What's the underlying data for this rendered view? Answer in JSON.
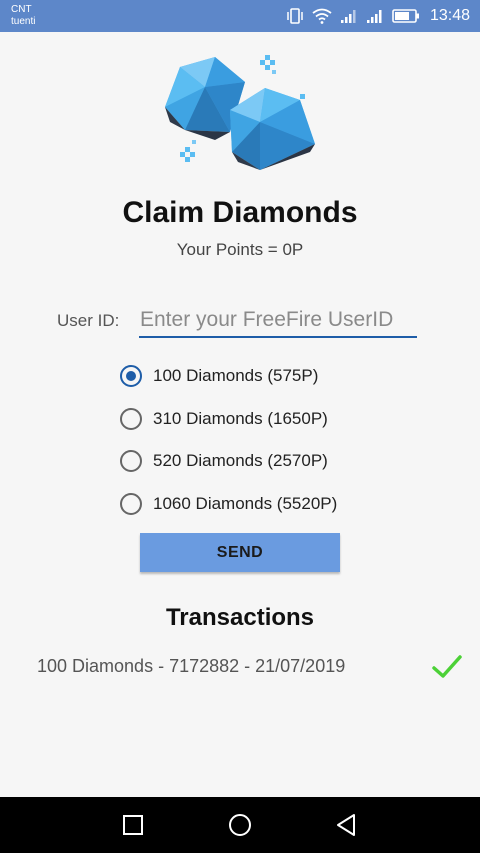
{
  "status_bar": {
    "carrier_line1": "CNT",
    "carrier_line2": "tuenti",
    "time": "13:48",
    "icons": [
      "vibrate-icon",
      "wifi-icon",
      "signal-icon",
      "signal-icon",
      "battery-icon"
    ]
  },
  "header": {
    "title": "Claim Diamonds",
    "points_text": "Your Points = 0P",
    "image": "diamond-gem-icon"
  },
  "form": {
    "user_id_label": "User ID:",
    "user_id_placeholder": "Enter your FreeFire UserID",
    "user_id_value": "",
    "options": [
      {
        "label": "100 Diamonds (575P)",
        "checked": true
      },
      {
        "label": "310 Diamonds (1650P)",
        "checked": false
      },
      {
        "label": "520 Diamonds (2570P)",
        "checked": false
      },
      {
        "label": "1060 Diamonds (5520P)",
        "checked": false
      }
    ],
    "send_label": "SEND"
  },
  "transactions": {
    "title": "Transactions",
    "items": [
      {
        "text": "100 Diamonds - 7172882 - 21/07/2019",
        "status_icon": "check-icon",
        "status_color": "#4cd137"
      }
    ]
  },
  "colors": {
    "status_bar": "#5d87c9",
    "accent": "#1e5da8",
    "button": "#6a9be0",
    "gem": "#3a9de0"
  },
  "nav_bar": {
    "icons": [
      "recents-square-icon",
      "home-circle-icon",
      "back-triangle-icon"
    ]
  }
}
